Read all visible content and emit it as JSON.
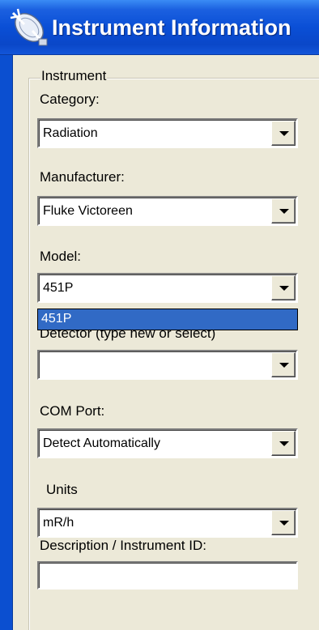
{
  "window": {
    "title": "Instrument Information",
    "icon": "satellite-dish-icon"
  },
  "group": {
    "legend": "Instrument"
  },
  "category": {
    "label": "Category:",
    "value": "Radiation"
  },
  "manufacturer": {
    "label": "Manufacturer:",
    "value": "Fluke Victoreen"
  },
  "model": {
    "label": "Model:",
    "value": "451P",
    "dropdown_items": [
      "451P"
    ]
  },
  "detector": {
    "label": "Detector (type new or select)",
    "value": ""
  },
  "com_port": {
    "label": "COM Port:",
    "value": "Detect Automatically"
  },
  "units": {
    "label": "Units",
    "value": "mR/h"
  },
  "description": {
    "label": "Description / Instrument ID:",
    "value": ""
  },
  "colors": {
    "titlebar": "#0a4fd6",
    "selection": "#316ac5",
    "window_bg": "#ece9d8"
  }
}
